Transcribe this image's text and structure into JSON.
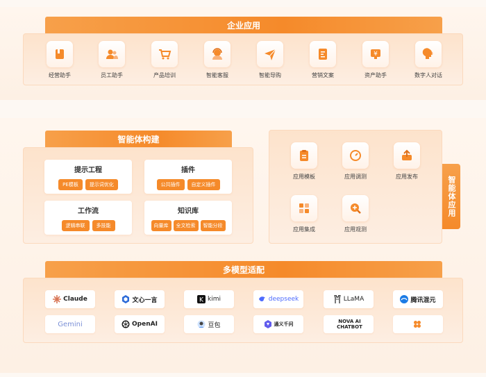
{
  "enterprise": {
    "title": "企业应用",
    "items": [
      {
        "label": "经营助手",
        "icon": "book-icon"
      },
      {
        "label": "员工助手",
        "icon": "users-icon"
      },
      {
        "label": "产品培训",
        "icon": "cart-icon"
      },
      {
        "label": "智能客服",
        "icon": "headset-icon"
      },
      {
        "label": "智能导购",
        "icon": "send-icon"
      },
      {
        "label": "营销文案",
        "icon": "document-icon"
      },
      {
        "label": "资产助手",
        "icon": "yen-icon"
      },
      {
        "label": "数字人对话",
        "icon": "head-icon"
      }
    ]
  },
  "agent_build": {
    "title": "智能体构建",
    "cards": [
      {
        "title": "提示工程",
        "chips": [
          "PE模板",
          "提示词优化"
        ]
      },
      {
        "title": "插件",
        "chips": [
          "公共插件",
          "自定义插件"
        ]
      },
      {
        "title": "工作流",
        "chips": [
          "逻辑串联",
          "多技能"
        ]
      },
      {
        "title": "知识库",
        "chips": [
          "向量库",
          "全文检索",
          "智能分段"
        ]
      }
    ]
  },
  "agent_app": {
    "title": "智能体应用",
    "items": [
      {
        "label": "应用模板",
        "icon": "clipboard-icon"
      },
      {
        "label": "应用调测",
        "icon": "gauge-icon"
      },
      {
        "label": "应用发布",
        "icon": "upload-icon"
      },
      {
        "label": "应用集成",
        "icon": "grid-icon"
      },
      {
        "label": "应用观测",
        "icon": "zoom-icon"
      }
    ]
  },
  "models": {
    "title": "多模型适配",
    "items": [
      {
        "label": "Claude",
        "icon": "claude-icon",
        "color": "#222222"
      },
      {
        "label": "文心一言",
        "icon": "wenxin-icon",
        "color": "#222222"
      },
      {
        "label": "kimi",
        "icon": "kimi-icon",
        "color": "#222222"
      },
      {
        "label": "deepseek",
        "icon": "deepseek-icon",
        "color": "#4d6bfe"
      },
      {
        "label": "LLaMA",
        "icon": "llama-icon",
        "color": "#222222"
      },
      {
        "label": "腾讯混元",
        "icon": "hunyuan-icon",
        "color": "#222222"
      },
      {
        "label": "Gemini",
        "icon": "gemini-icon",
        "color": "#7a8fd6"
      },
      {
        "label": "OpenAI",
        "icon": "openai-icon",
        "color": "#222222"
      },
      {
        "label": "豆包",
        "icon": "doubao-icon",
        "color": "#222222"
      },
      {
        "label": "通义千问",
        "icon": "tongyi-icon",
        "color": "#222222"
      },
      {
        "label": "NOVA AI CHATBOT",
        "icon": "nova-icon",
        "color": "#222222"
      },
      {
        "label": "",
        "icon": "flower-icon",
        "color": "#f58a2a"
      }
    ]
  },
  "colors": {
    "accent": "#f58a2a",
    "panel": "#fde3cc"
  }
}
